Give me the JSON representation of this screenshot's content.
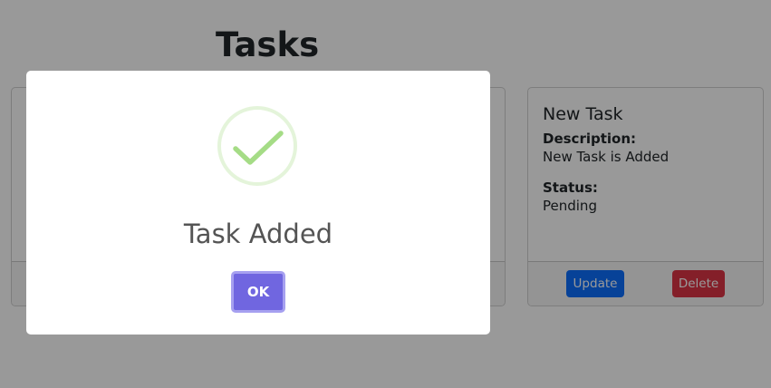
{
  "page": {
    "title": "Tasks"
  },
  "tasks": [
    {
      "title": "",
      "description_label": "",
      "description": "",
      "status_label": "",
      "status": "",
      "update_label": "",
      "delete_label": ""
    },
    {
      "title": "New Task",
      "description_label": "Description:",
      "description": "New Task is Added",
      "status_label": "Status:",
      "status": "Pending",
      "update_label": "Update",
      "delete_label": "Delete"
    }
  ],
  "modal": {
    "icon": "success-check-icon",
    "title": "Task Added",
    "ok_label": "OK"
  },
  "colors": {
    "update_button": "#0d6efd",
    "delete_button": "#dc3545",
    "ok_button": "#7066e0",
    "success_icon": "#a5dc86",
    "overlay": "rgba(0,0,0,0.4)"
  }
}
